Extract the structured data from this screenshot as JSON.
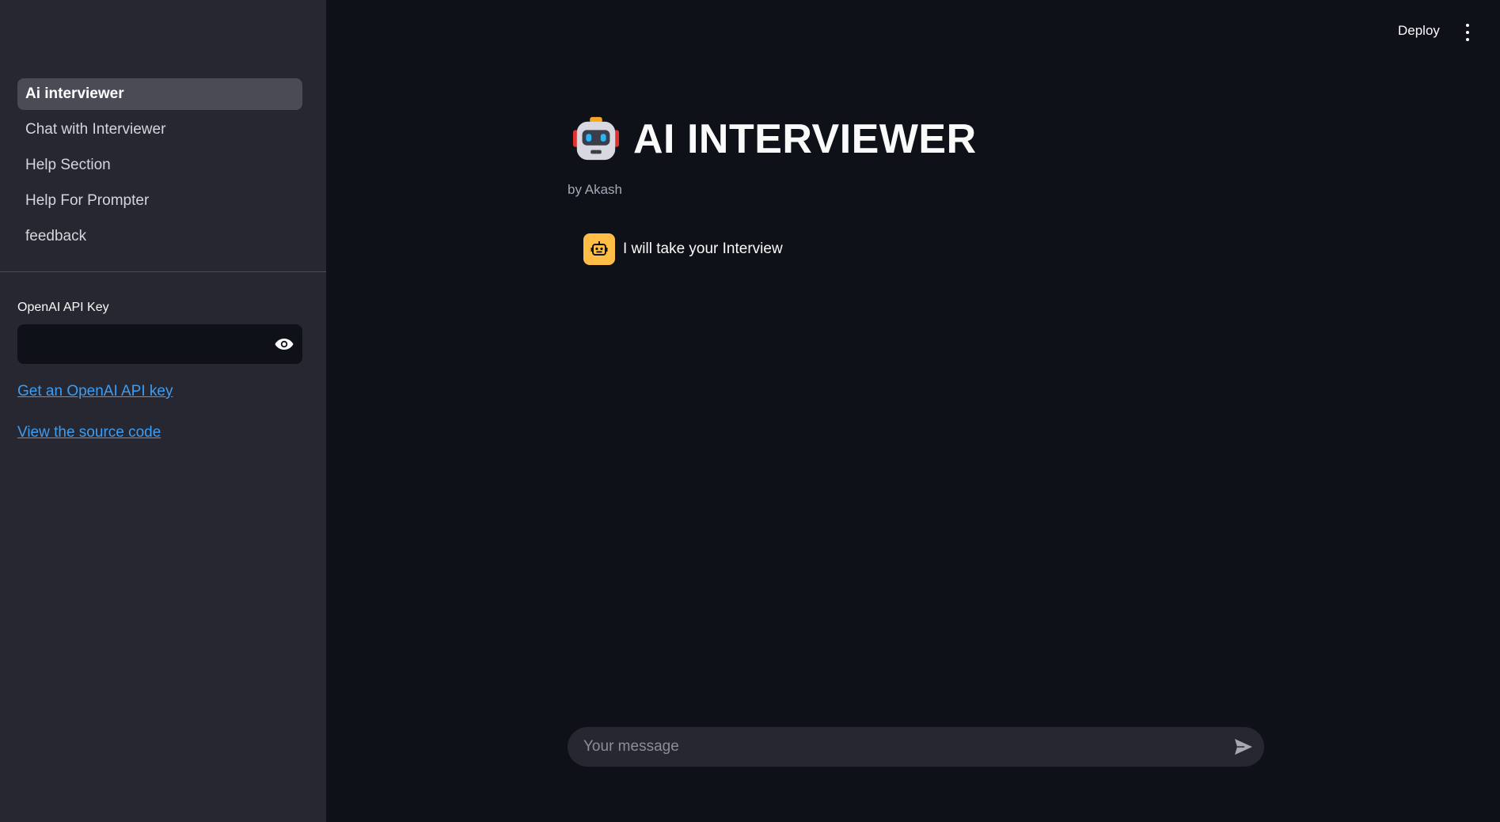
{
  "sidebar": {
    "nav_items": [
      {
        "label": "Ai interviewer",
        "active": true
      },
      {
        "label": "Chat with Interviewer",
        "active": false
      },
      {
        "label": "Help Section",
        "active": false
      },
      {
        "label": "Help For Prompter",
        "active": false
      },
      {
        "label": "feedback",
        "active": false
      }
    ],
    "api_key_label": "OpenAI API Key",
    "api_key_value": "",
    "links": {
      "get_key": "Get an OpenAI API key",
      "source": "View the source code"
    }
  },
  "header": {
    "deploy_label": "Deploy",
    "menu_icon": "more-vertical-icon"
  },
  "main": {
    "title_icon": "robot-emoji-icon",
    "title": "AI INTERVIEWER",
    "byline": "by Akash",
    "messages": [
      {
        "role": "assistant",
        "avatar_icon": "bot-avatar-icon",
        "text": "I will take your Interview"
      }
    ],
    "chat_input": {
      "placeholder": "Your message",
      "value": "",
      "send_icon": "send-icon"
    }
  },
  "colors": {
    "background": "#0e1117",
    "sidebar": "#262730",
    "active_nav": "#4a4b55",
    "link": "#3d9df3",
    "avatar_bg": "#ffbd45"
  }
}
